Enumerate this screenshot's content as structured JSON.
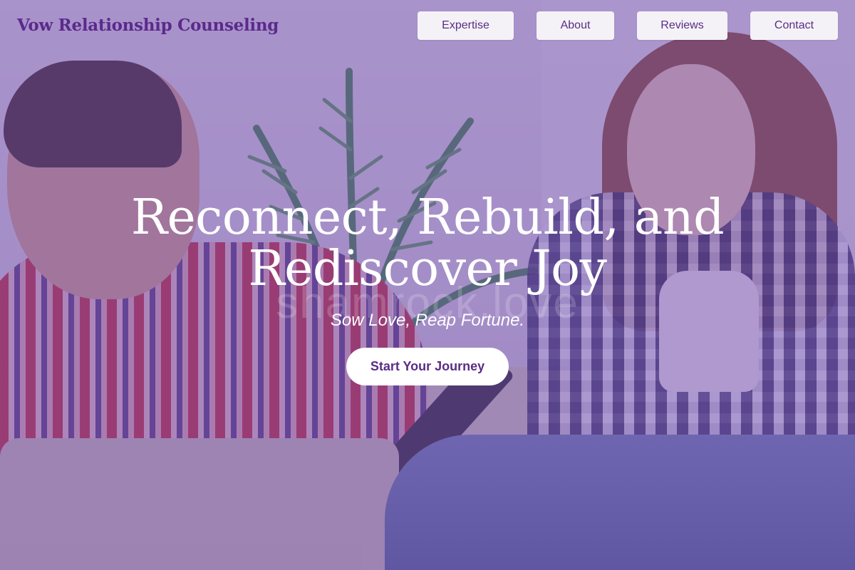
{
  "brand": {
    "name": "Vow Relationship Counseling"
  },
  "nav": {
    "expertise": "Expertise",
    "about": "About",
    "reviews": "Reviews",
    "contact": "Contact"
  },
  "hero": {
    "title_line1": "Reconnect, Rebuild, and",
    "title_line2": "Rediscover Joy",
    "watermark": "shamrock.love",
    "tagline": "Sow Love, Reap Fortune.",
    "cta_label": "Start Your Journey"
  },
  "colors": {
    "overlay": "#7048aa",
    "brand_text": "#5b2a8c",
    "button_bg": "#f4f2f7",
    "cta_text": "#5a2d86"
  }
}
